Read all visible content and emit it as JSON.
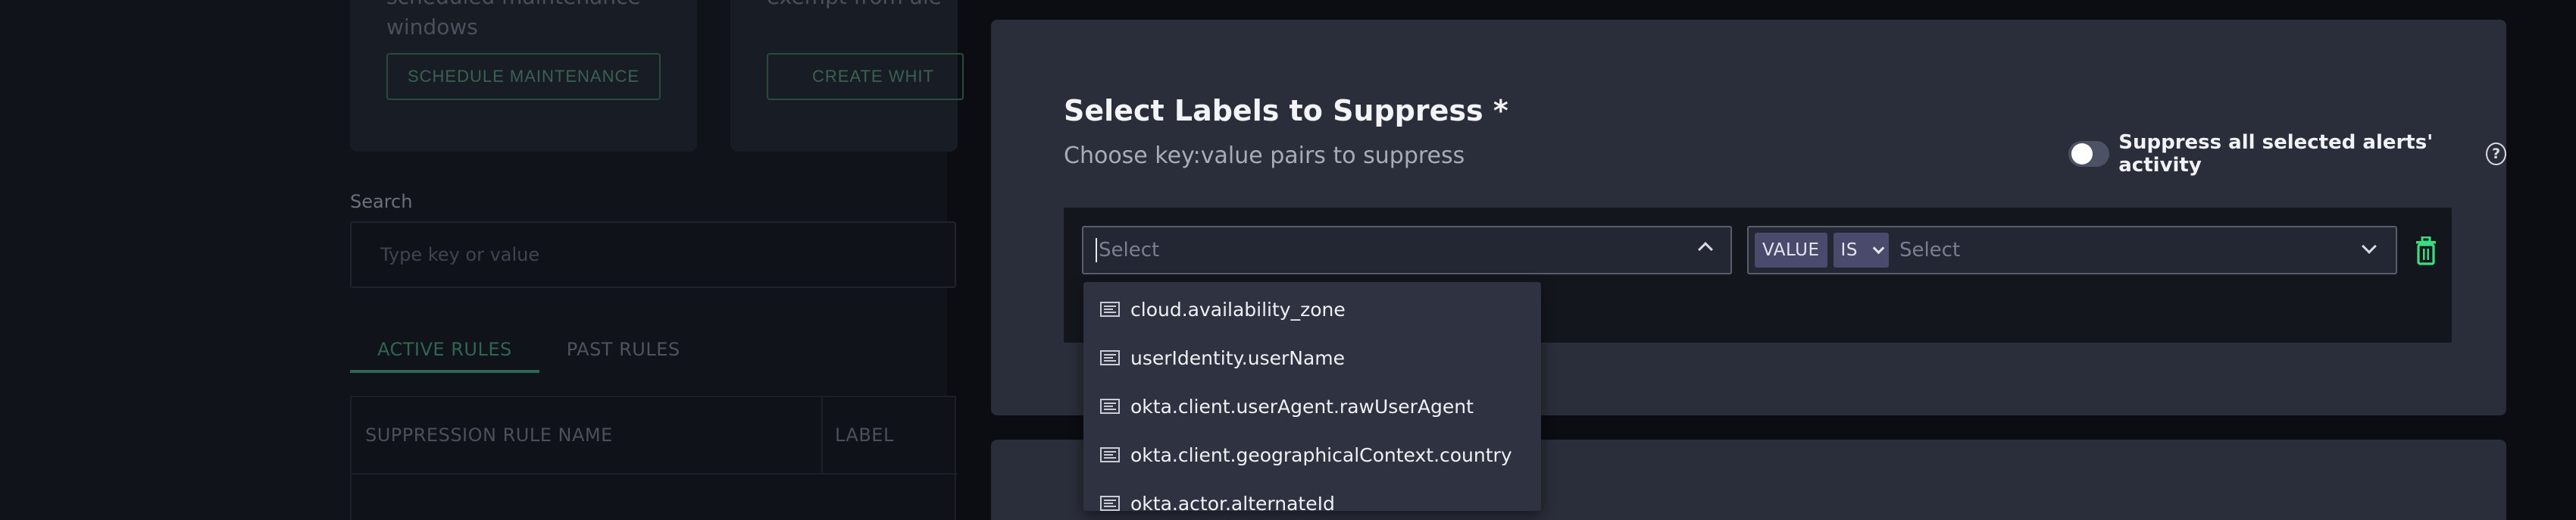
{
  "background": {
    "card1_text": "scheduled maintenance windows",
    "card1_button": "SCHEDULE MAINTENANCE",
    "card2_text": "exempt from ale",
    "card2_button": "CREATE WHIT",
    "search_label": "Search",
    "search_placeholder": "Type key or value",
    "tabs": [
      "ACTIVE RULES",
      "PAST RULES"
    ],
    "table_headers": [
      "SUPPRESSION RULE NAME",
      "LABEL"
    ]
  },
  "modal": {
    "title": "Select Labels to Suppress *",
    "subtitle": "Choose key:value pairs to suppress",
    "toggle_label": "Suppress all selected alerts' activity",
    "toggle_on": false,
    "help_icon_glyph": "?",
    "key_select_placeholder": "Select",
    "value_chip": "VALUE",
    "operator_chip": "IS",
    "value_select_placeholder": "Select",
    "delete_icon_color": "#3ddc84"
  },
  "dropdown": {
    "options": [
      "cloud.availability_zone",
      "userIdentity.userName",
      "okta.client.userAgent.rawUserAgent",
      "okta.client.geographicalContext.country",
      "okta.actor.alternateId"
    ]
  }
}
